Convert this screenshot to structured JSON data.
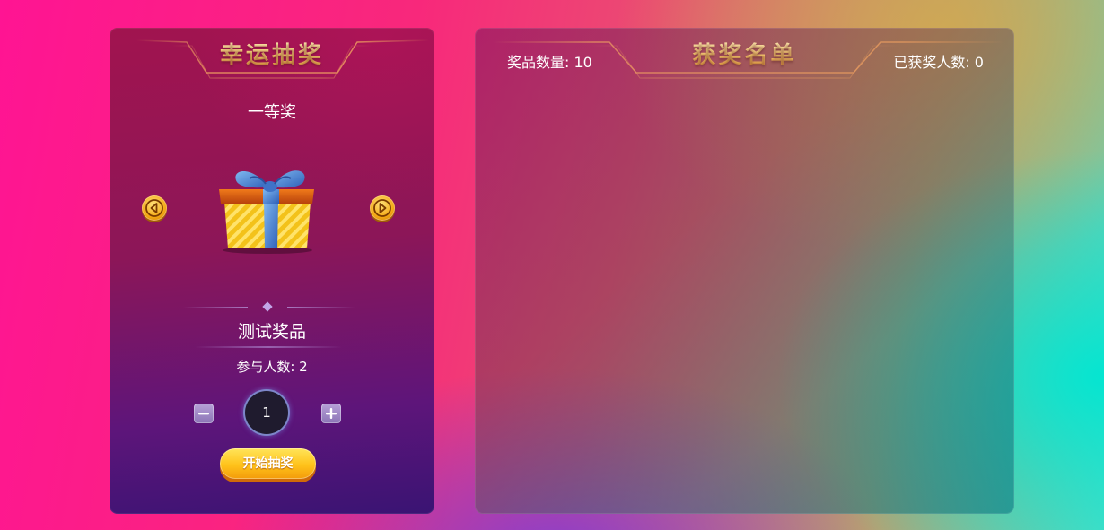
{
  "left_panel": {
    "title": "幸运抽奖",
    "prize_level": "一等奖",
    "prize_name": "测试奖品",
    "participants": "参与人数: 2",
    "quantity": "1",
    "start_button": "开始抽奖",
    "prev_icon": "chevron-left-icon",
    "next_icon": "chevron-right-icon",
    "minus_icon": "minus-icon",
    "plus_icon": "plus-icon",
    "gift_icon": "gift-box-icon"
  },
  "right_panel": {
    "title": "获奖名单",
    "prize_count": "奖品数量: 10",
    "winner_count": "已获奖人数: 0",
    "winners": []
  },
  "colors": {
    "title_gold": "#f4c46c",
    "button_yellow": "#ffc21a",
    "arrow_orange": "#f3a712"
  }
}
